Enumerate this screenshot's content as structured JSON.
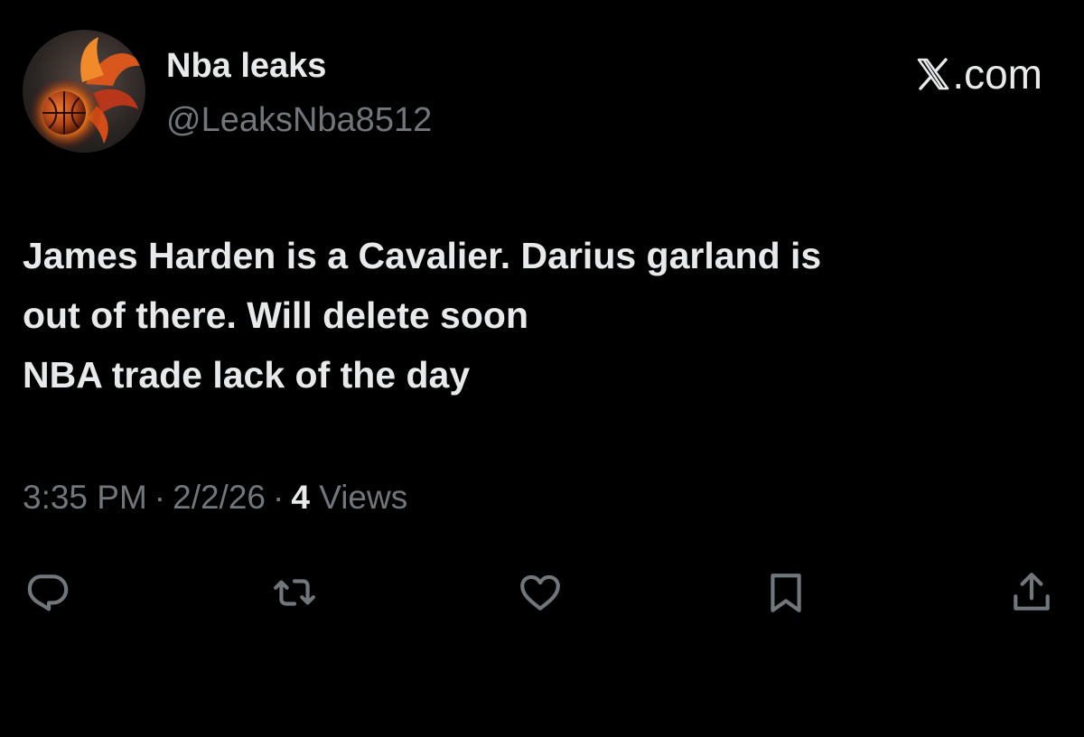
{
  "author": {
    "display_name": "Nba leaks",
    "handle": "@LeaksNba8512",
    "avatar_icon": "phoenix-basketball-icon"
  },
  "brand": {
    "label": ".com",
    "icon": "x-logo-icon"
  },
  "tweet": {
    "lines": [
      "James Harden is a Cavalier. Darius garland is",
      "out of there. Will delete soon",
      "NBA trade lack of the day"
    ]
  },
  "meta": {
    "time": "3:35 PM",
    "separator": "·",
    "date": "2/2/26",
    "views_count": "4",
    "views_label": "Views"
  },
  "actions": [
    {
      "name": "reply",
      "icon": "reply-icon"
    },
    {
      "name": "repost",
      "icon": "repost-icon"
    },
    {
      "name": "like",
      "icon": "heart-icon"
    },
    {
      "name": "bookmark",
      "icon": "bookmark-icon"
    },
    {
      "name": "share",
      "icon": "share-icon"
    }
  ],
  "colors": {
    "background": "#000000",
    "primary_text": "#e7e9ea",
    "secondary_text": "#71767b"
  }
}
